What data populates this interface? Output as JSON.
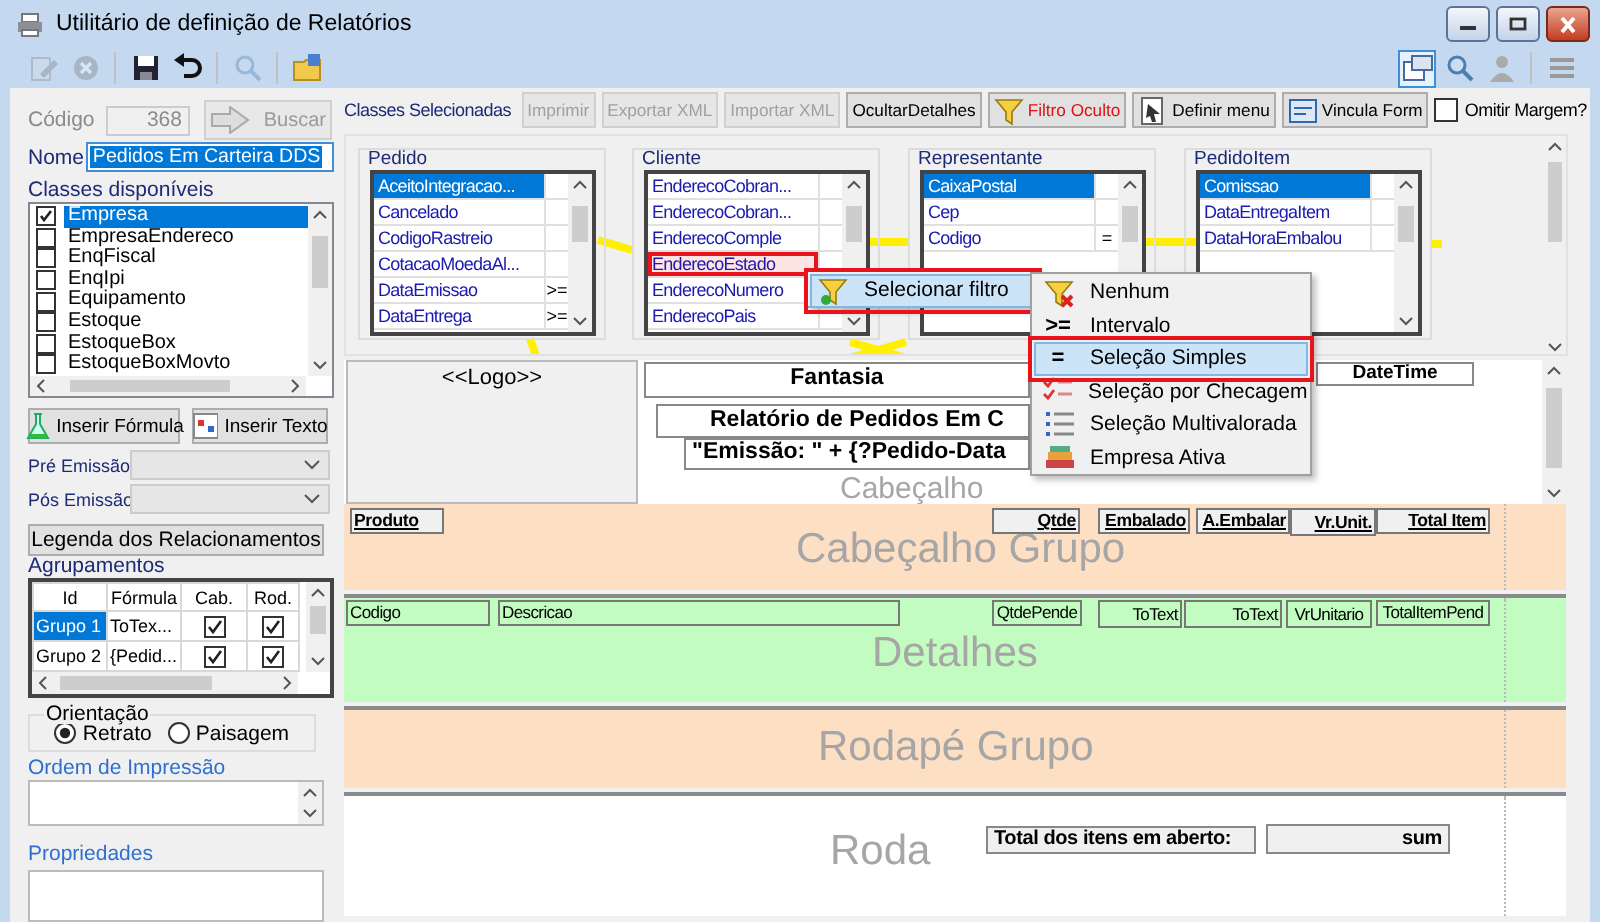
{
  "window": {
    "title": "Utilitário de definição de Relatórios"
  },
  "toolbar": {
    "left": [
      {
        "kind": "edit",
        "disabled": true
      },
      {
        "kind": "cancel",
        "disabled": true
      },
      {
        "kind": "save",
        "disabled": false
      },
      {
        "kind": "undo",
        "disabled": false
      },
      {
        "kind": "search",
        "disabled": true
      },
      {
        "kind": "folder",
        "disabled": false
      }
    ],
    "right": [
      {
        "kind": "layout",
        "selected": true
      },
      {
        "kind": "search",
        "selected": false
      },
      {
        "kind": "user",
        "selected": false
      },
      {
        "kind": "list",
        "selected": false
      }
    ]
  },
  "code": {
    "label": "Código",
    "value": "368",
    "disabled": true
  },
  "search_button": {
    "label": "Buscar",
    "disabled": true
  },
  "name": {
    "label": "Nome",
    "value": "Pedidos Em Carteira DDS"
  },
  "available_classes": {
    "label": "Classes disponíveis",
    "items": [
      {
        "name": "Empresa",
        "checked": true,
        "selected": true
      },
      {
        "name": "EmpresaEndereco",
        "checked": false,
        "selected": false
      },
      {
        "name": "EnqFiscal",
        "checked": false,
        "selected": false
      },
      {
        "name": "EnqIpi",
        "checked": false,
        "selected": false
      },
      {
        "name": "Equipamento",
        "checked": false,
        "selected": false
      },
      {
        "name": "Estoque",
        "checked": false,
        "selected": false
      },
      {
        "name": "EstoqueBox",
        "checked": false,
        "selected": false
      },
      {
        "name": "EstoqueBoxMovto",
        "checked": false,
        "selected": false
      }
    ]
  },
  "insert_buttons": [
    {
      "label": "Inserir Fórmula",
      "kind": "formula"
    },
    {
      "label": "Inserir Texto",
      "kind": "text"
    }
  ],
  "pre_emission": {
    "label": "Pré Emissão"
  },
  "post_emission": {
    "label": "Pós Emissão"
  },
  "legend_button": {
    "label": "Legenda dos Relacionamentos"
  },
  "groupings": {
    "label": "Agrupamentos",
    "columns": [
      "Id",
      "Fórmula",
      "Cab.",
      "Rod."
    ],
    "rows": [
      {
        "id": "Grupo 1",
        "formula": "ToTex...",
        "header": true,
        "footer": true,
        "selected": true
      },
      {
        "id": "Grupo 2",
        "formula": "{Pedid...",
        "header": true,
        "footer": true,
        "selected": false
      }
    ]
  },
  "orientation": {
    "label": "Orientação",
    "options": [
      {
        "label": "Retrato",
        "selected": true
      },
      {
        "label": "Paisagem",
        "selected": false
      }
    ]
  },
  "print_order": {
    "label": "Ordem de Impressão"
  },
  "properties": {
    "label": "Propriedades"
  },
  "selected_classes": {
    "label": "Classes Selecionadas"
  },
  "actions": [
    {
      "label": "Imprimir",
      "kind": "plain",
      "disabled": true,
      "active": false
    },
    {
      "label": "Exportar XML",
      "kind": "plain",
      "disabled": true,
      "active": false
    },
    {
      "label": "Importar XML",
      "kind": "plain",
      "disabled": true,
      "active": false
    },
    {
      "label": "OcultarDetalhes",
      "kind": "plain",
      "disabled": false,
      "active": false
    },
    {
      "label": "Filtro Oculto",
      "kind": "filter",
      "disabled": false,
      "active": true
    },
    {
      "label": "Definir menu",
      "kind": "menu",
      "disabled": false,
      "active": false
    },
    {
      "label": "Vincula Form",
      "kind": "form",
      "disabled": false,
      "active": false
    }
  ],
  "omit_margin": {
    "label": "Omitir Margem?",
    "checked": false
  },
  "tables": [
    {
      "title": "Pedido",
      "fields": [
        {
          "name": "AceitoIntegracao...",
          "selected": true,
          "highlighted": false
        },
        {
          "name": "Cancelado",
          "selected": false,
          "highlighted": false
        },
        {
          "name": "CodigoRastreio",
          "selected": false,
          "highlighted": false
        },
        {
          "name": "CotacaoMoedaAl...",
          "selected": false,
          "highlighted": false
        },
        {
          "name": "DataEmissao",
          "filter": ">=",
          "selected": false,
          "highlighted": false
        },
        {
          "name": "DataEntrega",
          "filter": ">=",
          "selected": false,
          "highlighted": false
        }
      ]
    },
    {
      "title": "Cliente",
      "fields": [
        {
          "name": "EnderecoCobran...",
          "selected": false,
          "highlighted": false
        },
        {
          "name": "EnderecoCobran...",
          "selected": false,
          "highlighted": false
        },
        {
          "name": "EnderecoComple",
          "selected": false,
          "highlighted": false
        },
        {
          "name": "EnderecoEstado",
          "selected": false,
          "highlighted": true
        },
        {
          "name": "EnderecoNumero",
          "selected": false,
          "highlighted": false
        },
        {
          "name": "EnderecoPais",
          "selected": false,
          "highlighted": false
        }
      ]
    },
    {
      "title": "Representante",
      "fields": [
        {
          "name": "CaixaPostal",
          "selected": true,
          "highlighted": false
        },
        {
          "name": "Cep",
          "selected": false,
          "highlighted": false
        },
        {
          "name": "Codigo",
          "filter": "=",
          "selected": false,
          "highlighted": false
        }
      ]
    },
    {
      "title": "PedidoItem",
      "fields": [
        {
          "name": "Comissao",
          "selected": true,
          "highlighted": false
        },
        {
          "name": "DataEntregaItem",
          "selected": false,
          "highlighted": false
        },
        {
          "name": "DataHoraEmbalou",
          "selected": false,
          "highlighted": false
        }
      ]
    }
  ],
  "report": {
    "bands": [
      {
        "kind": "header",
        "title": "Cabeçalho",
        "fields": [
          {
            "text": "<<Logo>>",
            "kind": "logo"
          },
          {
            "text": "Fantasia",
            "kind": "heading"
          },
          {
            "text": "Relatório de Pedidos Em C",
            "kind": "heading"
          },
          {
            "text": "\"Emissão: \" + {?Pedido-Data",
            "kind": "heading"
          },
          {
            "text": "DateTime",
            "kind": "heading"
          }
        ]
      },
      {
        "kind": "group_header",
        "title": "Cabeçalho Grupo",
        "fields": [
          {
            "text": "Produto",
            "kind": "label"
          },
          {
            "text": "Qtde",
            "kind": "label"
          },
          {
            "text": "Embalado",
            "kind": "label"
          },
          {
            "text": "A.Embalar",
            "kind": "label"
          },
          {
            "text": "Vr.Unit.",
            "kind": "label"
          },
          {
            "text": "Total Item",
            "kind": "label"
          }
        ]
      },
      {
        "kind": "detail",
        "title": "Detalhes",
        "fields": [
          {
            "text": "Codigo",
            "kind": "data"
          },
          {
            "text": "Descricao",
            "kind": "data"
          },
          {
            "text": "QtdePende",
            "kind": "data"
          },
          {
            "text": "ToText",
            "kind": "data"
          },
          {
            "text": "ToText",
            "kind": "data"
          },
          {
            "text": "VrUnitario",
            "kind": "data"
          },
          {
            "text": "TotalItemPend",
            "kind": "data"
          }
        ]
      },
      {
        "kind": "group_footer",
        "title": "Rodapé Grupo"
      },
      {
        "kind": "footer",
        "title": "Roda",
        "fields": [
          {
            "text": "Total dos itens em aberto:",
            "kind": "total"
          },
          {
            "text": "sum",
            "kind": "total"
          }
        ]
      }
    ]
  },
  "context_menu": {
    "items": [
      {
        "label": "Selecionar filtro",
        "selected": true,
        "highlighted": true
      }
    ],
    "submenu": [
      {
        "label": "Nenhum",
        "kind": "none",
        "selected": false,
        "highlighted": false
      },
      {
        "label": "Intervalo",
        "kind": "glyph",
        "glyph": ">=",
        "selected": false,
        "highlighted": false
      },
      {
        "label": "Seleção Simples",
        "kind": "glyph",
        "glyph": "=",
        "selected": true,
        "highlighted": true
      },
      {
        "label": "Seleção por Checagem",
        "kind": "check",
        "selected": false,
        "highlighted": false
      },
      {
        "label": "Seleção Multivalorada",
        "kind": "multi",
        "selected": false,
        "highlighted": false
      },
      {
        "label": "Empresa Ativa",
        "kind": "company",
        "selected": false,
        "highlighted": false
      }
    ]
  }
}
